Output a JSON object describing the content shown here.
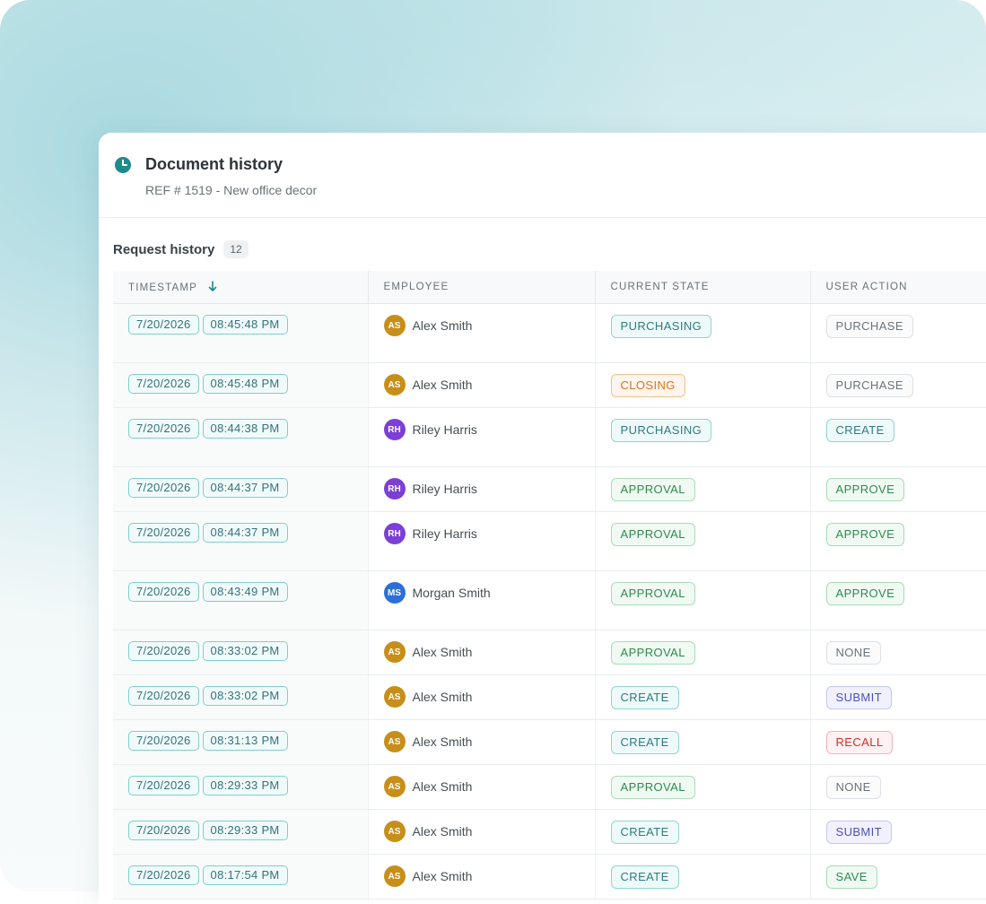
{
  "panel": {
    "title": "Document history",
    "subtitle": "REF # 1519 - New office decor"
  },
  "section": {
    "title": "Request history",
    "count": "12"
  },
  "columns": {
    "timestamp": "TIMESTAMP",
    "employee": "EMPLOYEE",
    "state": "CURRENT STATE",
    "action": "USER ACTION"
  },
  "colors": {
    "accent": "#1f8a8a",
    "avatar_as": "#c78e19",
    "avatar_rh": "#7b3fd6",
    "avatar_ms": "#2c6fd6"
  },
  "rows": [
    {
      "date": "7/20/2026",
      "time": "08:45:48 PM",
      "initials": "AS",
      "name": "Alex Smith",
      "state": "PURCHASING",
      "action": "PURCHASE",
      "tall": true
    },
    {
      "date": "7/20/2026",
      "time": "08:45:48 PM",
      "initials": "AS",
      "name": "Alex Smith",
      "state": "CLOSING",
      "action": "PURCHASE",
      "tall": false
    },
    {
      "date": "7/20/2026",
      "time": "08:44:38 PM",
      "initials": "RH",
      "name": "Riley Harris",
      "state": "PURCHASING",
      "action": "CREATE",
      "tall": true
    },
    {
      "date": "7/20/2026",
      "time": "08:44:37 PM",
      "initials": "RH",
      "name": "Riley Harris",
      "state": "APPROVAL",
      "action": "APPROVE",
      "tall": false
    },
    {
      "date": "7/20/2026",
      "time": "08:44:37 PM",
      "initials": "RH",
      "name": "Riley Harris",
      "state": "APPROVAL",
      "action": "APPROVE",
      "tall": true
    },
    {
      "date": "7/20/2026",
      "time": "08:43:49 PM",
      "initials": "MS",
      "name": "Morgan Smith",
      "state": "APPROVAL",
      "action": "APPROVE",
      "tall": true
    },
    {
      "date": "7/20/2026",
      "time": "08:33:02 PM",
      "initials": "AS",
      "name": "Alex Smith",
      "state": "APPROVAL",
      "action": "NONE",
      "tall": false
    },
    {
      "date": "7/20/2026",
      "time": "08:33:02 PM",
      "initials": "AS",
      "name": "Alex Smith",
      "state": "CREATE",
      "action": "SUBMIT",
      "tall": false
    },
    {
      "date": "7/20/2026",
      "time": "08:31:13 PM",
      "initials": "AS",
      "name": "Alex Smith",
      "state": "CREATE",
      "action": "RECALL",
      "tall": false
    },
    {
      "date": "7/20/2026",
      "time": "08:29:33 PM",
      "initials": "AS",
      "name": "Alex Smith",
      "state": "APPROVAL",
      "action": "NONE",
      "tall": false
    },
    {
      "date": "7/20/2026",
      "time": "08:29:33 PM",
      "initials": "AS",
      "name": "Alex Smith",
      "state": "CREATE",
      "action": "SUBMIT",
      "tall": false
    },
    {
      "date": "7/20/2026",
      "time": "08:17:54 PM",
      "initials": "AS",
      "name": "Alex Smith",
      "state": "CREATE",
      "action": "SAVE",
      "tall": false
    }
  ]
}
